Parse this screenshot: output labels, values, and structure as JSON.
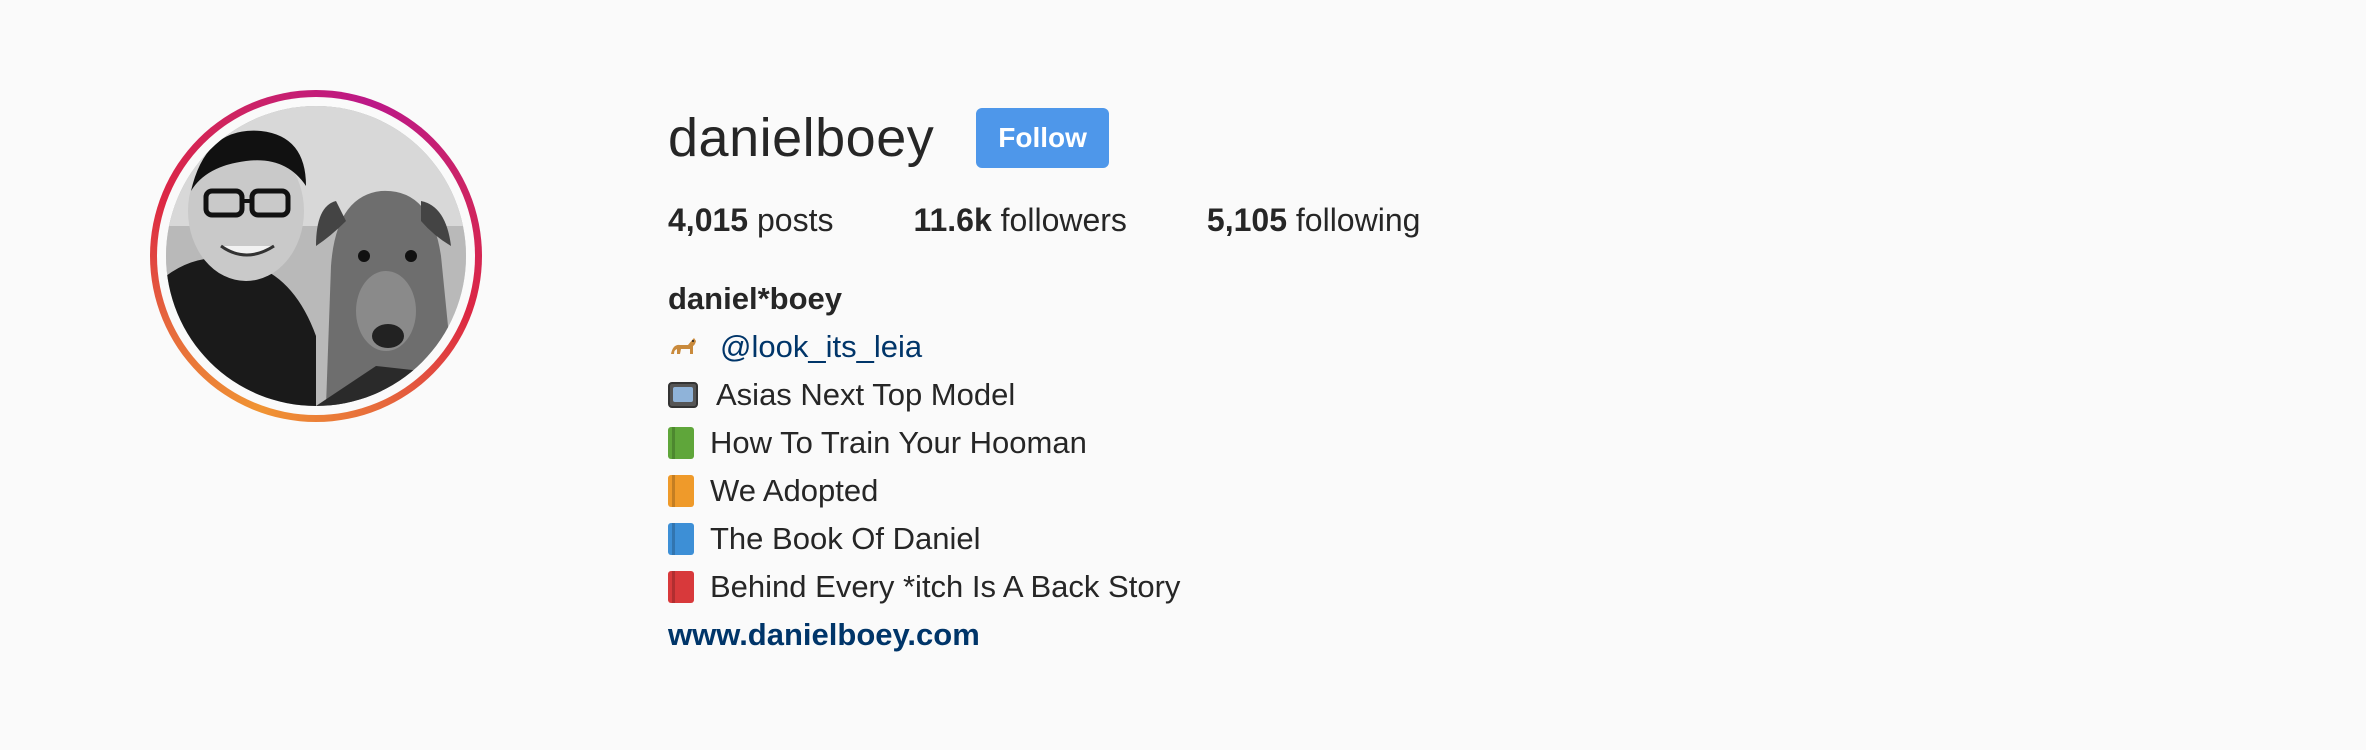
{
  "profile": {
    "username": "danielboey",
    "follow_label": "Follow",
    "stats": {
      "posts_count": "4,015",
      "posts_label": "posts",
      "followers_count": "11.6k",
      "followers_label": "followers",
      "following_count": "5,105",
      "following_label": "following"
    },
    "full_name": "daniel*boey",
    "bio": {
      "mention": "@look_its_leia",
      "tv_line": "Asias Next Top Model",
      "book_green": "How To Train Your Hooman",
      "book_orange": "We Adopted",
      "book_blue": "The Book Of Daniel",
      "book_red": "Behind Every *itch Is A Back Story"
    },
    "website": "www.danielboey.com"
  },
  "colors": {
    "follow_button": "#4e97ea",
    "link": "#003569",
    "text": "#262626",
    "background": "#fafafa"
  },
  "icons": {
    "dog": "dog-emoji-icon",
    "tv": "television-emoji-icon",
    "books": [
      "green-book-icon",
      "orange-book-icon",
      "blue-book-icon",
      "red-book-icon"
    ]
  }
}
